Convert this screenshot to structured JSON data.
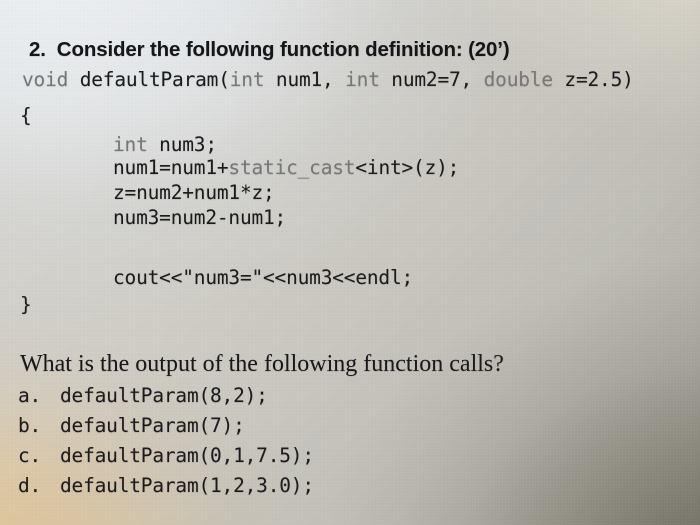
{
  "document": {
    "heading": {
      "number": "2.",
      "text": "Consider the following function definition:  (20’)"
    },
    "code": {
      "signature_keyword": "void",
      "signature_rest": " defaultParam(",
      "param1_type": "int",
      "param1_rest": " num1, ",
      "param2_type": "int",
      "param2_rest": " num2=7, ",
      "param3_type": "double",
      "param3_rest": " z=2.5)",
      "open_brace": "{",
      "line1_type": "int",
      "line1_rest": " num3;",
      "line2": "num1=num1+",
      "line2_keyword": "static_cast",
      "line2_rest": "<int>(z);",
      "line3": "z=num2+num1*z;",
      "line4": "num3=num2-num1;",
      "line5": "cout<<\"num3=\"<<num3<<endl;",
      "close_brace": "}"
    },
    "question": "What is the output of the following function calls?",
    "choices": [
      {
        "marker": "a.",
        "call": "defaultParam(8,2);"
      },
      {
        "marker": "b.",
        "call": "defaultParam(7);"
      },
      {
        "marker": "c.",
        "call": "defaultParam(0,1,7.5);"
      },
      {
        "marker": "d.",
        "call": "defaultParam(1,2,3.0);"
      }
    ]
  }
}
